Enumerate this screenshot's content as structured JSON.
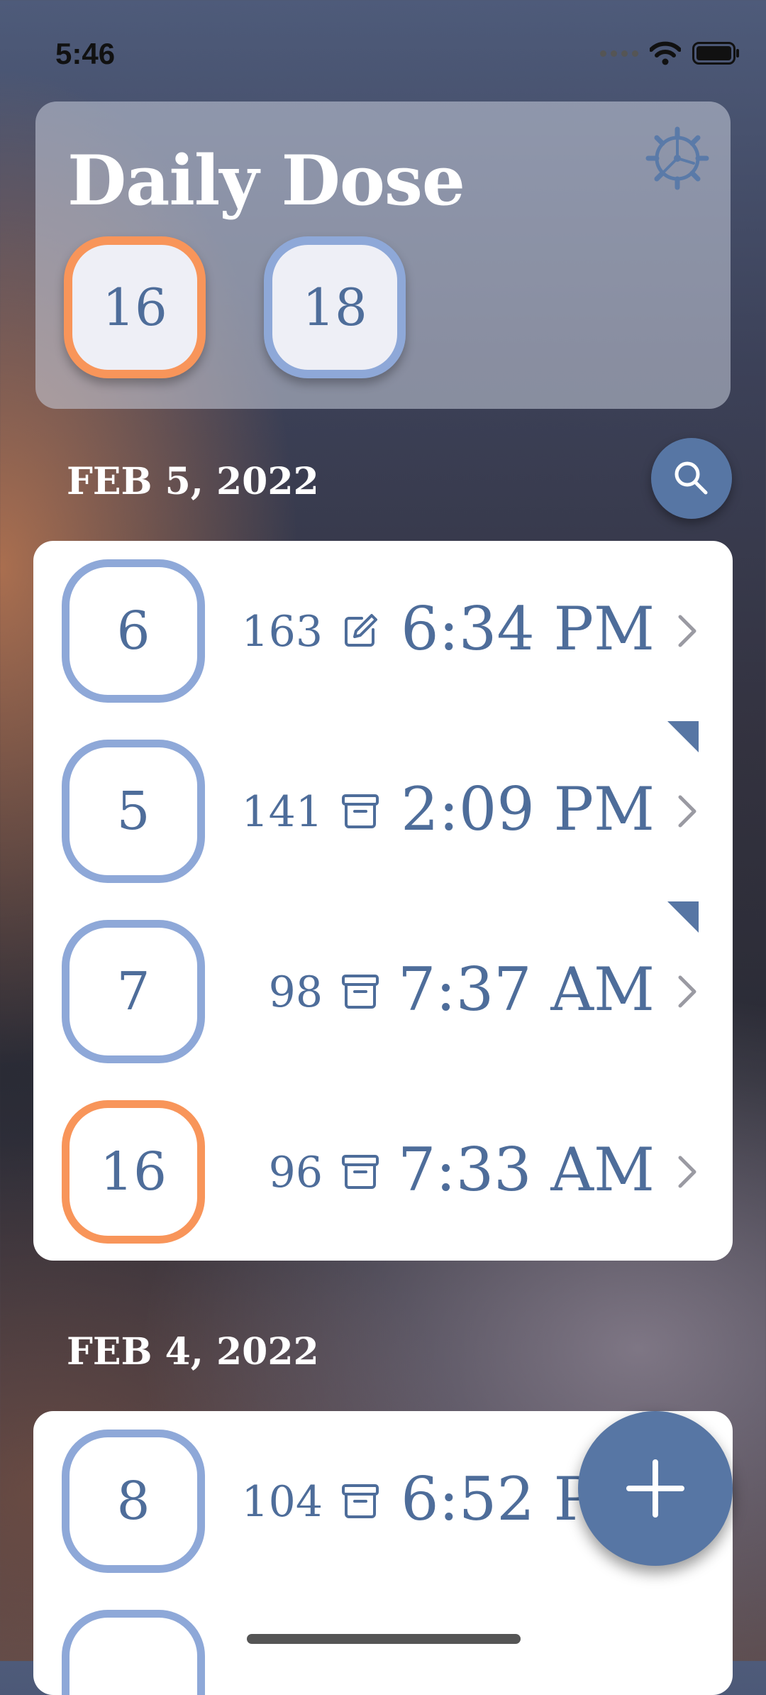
{
  "status": {
    "time": "5:46",
    "icons": [
      "signal-icon",
      "wifi-icon",
      "battery-icon"
    ]
  },
  "header": {
    "title": "Daily Dose",
    "settings_icon": "gear-icon",
    "summaries": [
      {
        "value": "16",
        "color": "orange"
      },
      {
        "value": "18",
        "color": "blue"
      }
    ]
  },
  "search_icon": "search-icon",
  "sections": [
    {
      "date": "FEB 5, 2022",
      "entries": [
        {
          "badge": "6",
          "badge_color": "blue",
          "count": "163",
          "icon": "edit-icon",
          "time": "6:34 PM",
          "flagged": false
        },
        {
          "badge": "5",
          "badge_color": "blue",
          "count": "141",
          "icon": "archive-icon",
          "time": "2:09 PM",
          "flagged": true
        },
        {
          "badge": "7",
          "badge_color": "blue",
          "count": "98",
          "icon": "archive-icon",
          "time": "7:37 AM",
          "flagged": true
        },
        {
          "badge": "16",
          "badge_color": "orange",
          "count": "96",
          "icon": "archive-icon",
          "time": "7:33 AM",
          "flagged": false
        }
      ]
    },
    {
      "date": "FEB 4, 2022",
      "entries": [
        {
          "badge": "8",
          "badge_color": "blue",
          "count": "104",
          "icon": "archive-icon",
          "time": "6:52 PM",
          "flagged": false
        },
        {
          "badge": "",
          "badge_color": "blue",
          "count": "",
          "icon": "archive-icon",
          "time": "",
          "flagged": false
        }
      ]
    }
  ],
  "add_icon": "plus-icon",
  "colors": {
    "accent": "#5776a4",
    "orange": "#f8955a",
    "blue": "#8ea8d8",
    "text": "#4e6d9a"
  }
}
